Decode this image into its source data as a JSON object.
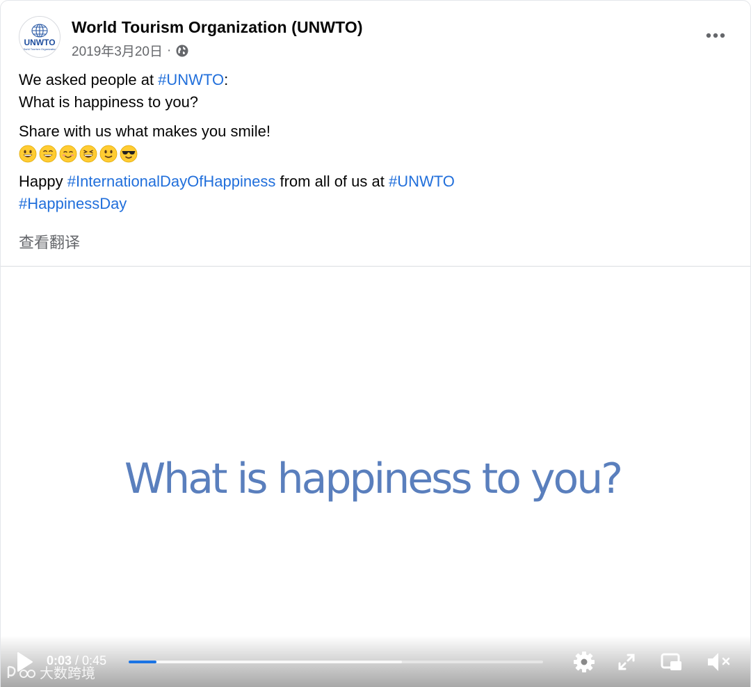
{
  "post": {
    "page_name": "World Tourism Organization (UNWTO)",
    "date": "2019年3月20日",
    "separator": "·",
    "avatar_logo_text": "UNWTO",
    "avatar_logo_subtext": "World Tourism Organization",
    "line1_prefix": "We asked people at ",
    "line1_hashtag": "#UNWTO",
    "line1_suffix": ":",
    "line2": "What is happiness to you?",
    "line3": "Share with us what makes you smile!",
    "emojis": [
      "grinning-face",
      "grinning-squinting-face",
      "smiling-face",
      "laughing-face",
      "slightly-smiling-face",
      "smiling-face-with-sunglasses"
    ],
    "line4_prefix": "Happy ",
    "line4_hashtag": "#InternationalDayOfHappiness",
    "line4_middle": " from all of us at ",
    "line4_hashtag2": "#UNWTO",
    "line5_hashtag": "#HappinessDay",
    "see_translation": "查看翻译",
    "more_icon": "more-dots-icon",
    "globe_icon": "globe-icon"
  },
  "video": {
    "title_text": "What is happiness to you?",
    "title_color": "#5a7fbd",
    "current_time": "0:03",
    "time_separator": " / ",
    "total_time": "0:45",
    "progress_fraction": 0.067,
    "buffer_fraction": 0.66,
    "accent_color": "#1b74e4",
    "icons": [
      "play-icon",
      "settings-gear-icon",
      "fullscreen-expand-icon",
      "picture-in-picture-icon",
      "volume-muted-icon"
    ]
  },
  "watermark": {
    "text": "大数跨境"
  }
}
